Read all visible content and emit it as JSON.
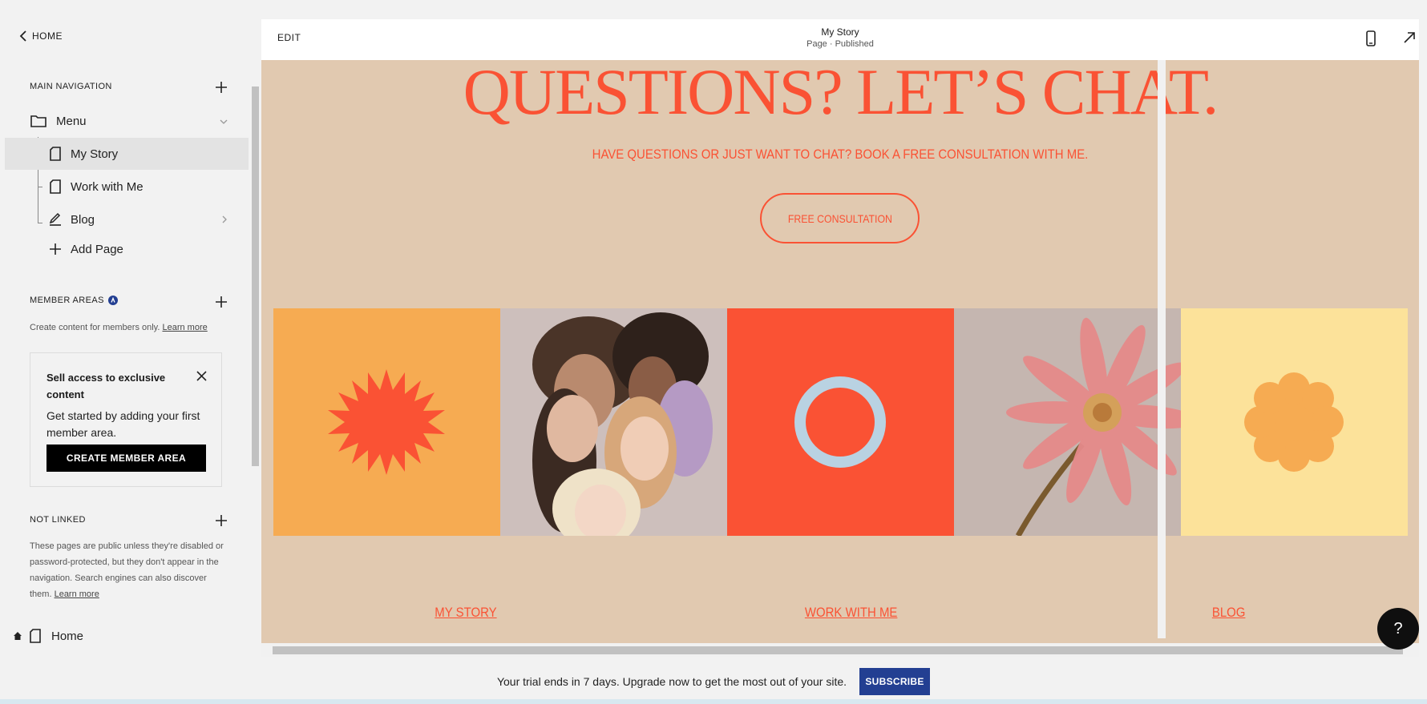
{
  "sidebar": {
    "back_label": "HOME",
    "main_nav_title": "MAIN NAVIGATION",
    "items": [
      {
        "label": "Menu"
      },
      {
        "label": "My Story"
      },
      {
        "label": "Work with Me"
      },
      {
        "label": "Blog"
      },
      {
        "label": "Add Page"
      }
    ],
    "member_areas_title": "MEMBER AREAS",
    "member_areas_desc": "Create content for members only.",
    "learn_more": "Learn more",
    "promo": {
      "title": "Sell access to exclusive content",
      "body": "Get started by adding your first member area.",
      "button": "CREATE MEMBER AREA"
    },
    "not_linked_title": "NOT LINKED",
    "not_linked_desc_lines": [
      "These pages are public unless they're disabled or",
      "password-protected, but they don't appear in the",
      "navigation. Search engines can also discover",
      "them."
    ],
    "home_item": "Home"
  },
  "preview": {
    "edit_label": "EDIT",
    "page_title": "My Story",
    "page_status": "Page · Published",
    "headline": "QUESTIONS? LET’S CHAT.",
    "subline": "HAVE QUESTIONS OR JUST WANT TO CHAT? BOOK A FREE CONSULTATION WITH ME.",
    "cta": "FREE CONSULTATION",
    "footer_links": [
      "MY STORY",
      "WORK WITH ME",
      "BLOG"
    ],
    "help": "?"
  },
  "trial": {
    "message": "Your trial ends in 7 days. Upgrade now to get the most out of your site.",
    "button": "SUBSCRIBE"
  },
  "colors": {
    "accent": "#fa5234",
    "canvas_bg": "#e1c9b0",
    "subscribe": "#233f92",
    "tile_orange": "#f6ab52",
    "tile_red": "#fa5234",
    "tile_yellow": "#fce29a",
    "ring": "#b9d2e2"
  },
  "icons": [
    "chevron-left-icon",
    "plus-icon",
    "folder-icon",
    "chevron-down-icon",
    "page-icon",
    "blog-icon",
    "chevron-right-icon",
    "lock-badge-icon",
    "close-icon",
    "home-icon",
    "mobile-icon",
    "expand-icon"
  ]
}
